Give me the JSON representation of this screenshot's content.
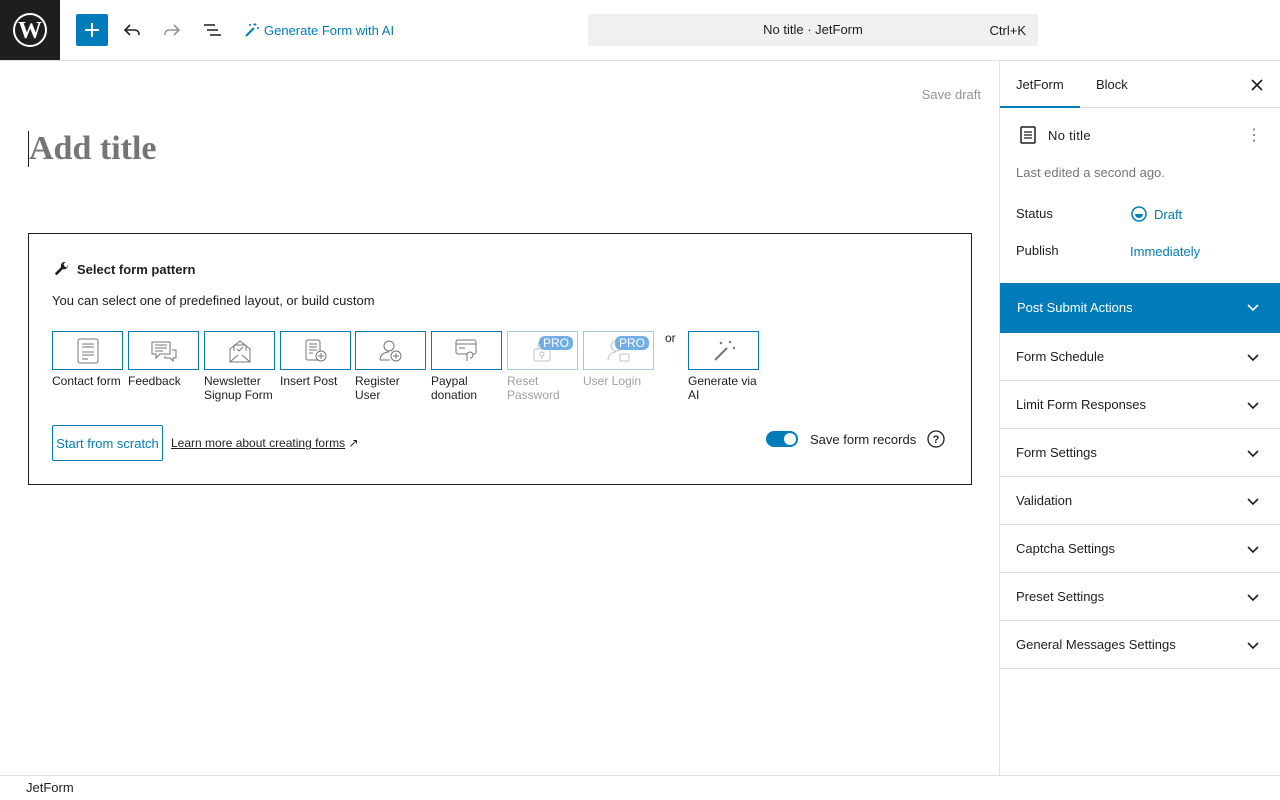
{
  "topbar": {
    "wp_logo_icon": "wordpress-logo",
    "add_icon": "plus-icon",
    "undo_icon": "undo-icon",
    "redo_icon": "redo-icon",
    "list_view_icon": "list-view-icon",
    "generate_ai_label": "Generate Form with AI",
    "command_title": "No title · JetForm",
    "command_shortcut": "Ctrl+K"
  },
  "editor": {
    "save_draft": "Save draft",
    "title_placeholder": "Add title",
    "pattern_heading": "Select form pattern",
    "pattern_description": "You can select one of predefined layout, or build custom",
    "patterns": [
      {
        "label": "Contact form",
        "icon": "contact-form-icon",
        "pro": false
      },
      {
        "label": "Feedback",
        "icon": "feedback-icon",
        "pro": false
      },
      {
        "label": "Newsletter Signup Form",
        "icon": "newsletter-icon",
        "pro": false
      },
      {
        "label": "Insert Post",
        "icon": "insert-post-icon",
        "pro": false
      },
      {
        "label": "Register User",
        "icon": "register-user-icon",
        "pro": false
      },
      {
        "label": "Paypal donation",
        "icon": "paypal-icon",
        "pro": false
      },
      {
        "label": "Reset Password",
        "icon": "reset-password-icon",
        "pro": true
      },
      {
        "label": "User Login",
        "icon": "user-login-icon",
        "pro": true
      }
    ],
    "pro_badge": "PRO",
    "or_label": "or",
    "generate_ai_pattern": "Generate via AI",
    "start_scratch": "Start from scratch",
    "learn_more": "Learn more about creating forms",
    "learn_more_arrow": "↗",
    "save_records_label": "Save form records",
    "save_records_on": true
  },
  "sidebar": {
    "tabs": [
      "JetForm",
      "Block"
    ],
    "active_tab": "JetForm",
    "doc_title": "No title",
    "last_edited": "Last edited a second ago.",
    "status_label": "Status",
    "status_value": "Draft",
    "publish_label": "Publish",
    "publish_value": "Immediately",
    "panels": [
      "Post Submit Actions",
      "Form Schedule",
      "Limit Form Responses",
      "Form Settings",
      "Validation",
      "Captcha Settings",
      "Preset Settings",
      "General Messages Settings"
    ],
    "active_panel": "Post Submit Actions"
  },
  "footer": {
    "breadcrumb": "JetForm"
  },
  "colors": {
    "accent": "#007cba",
    "dark": "#1e1e1e",
    "muted": "#757575"
  }
}
